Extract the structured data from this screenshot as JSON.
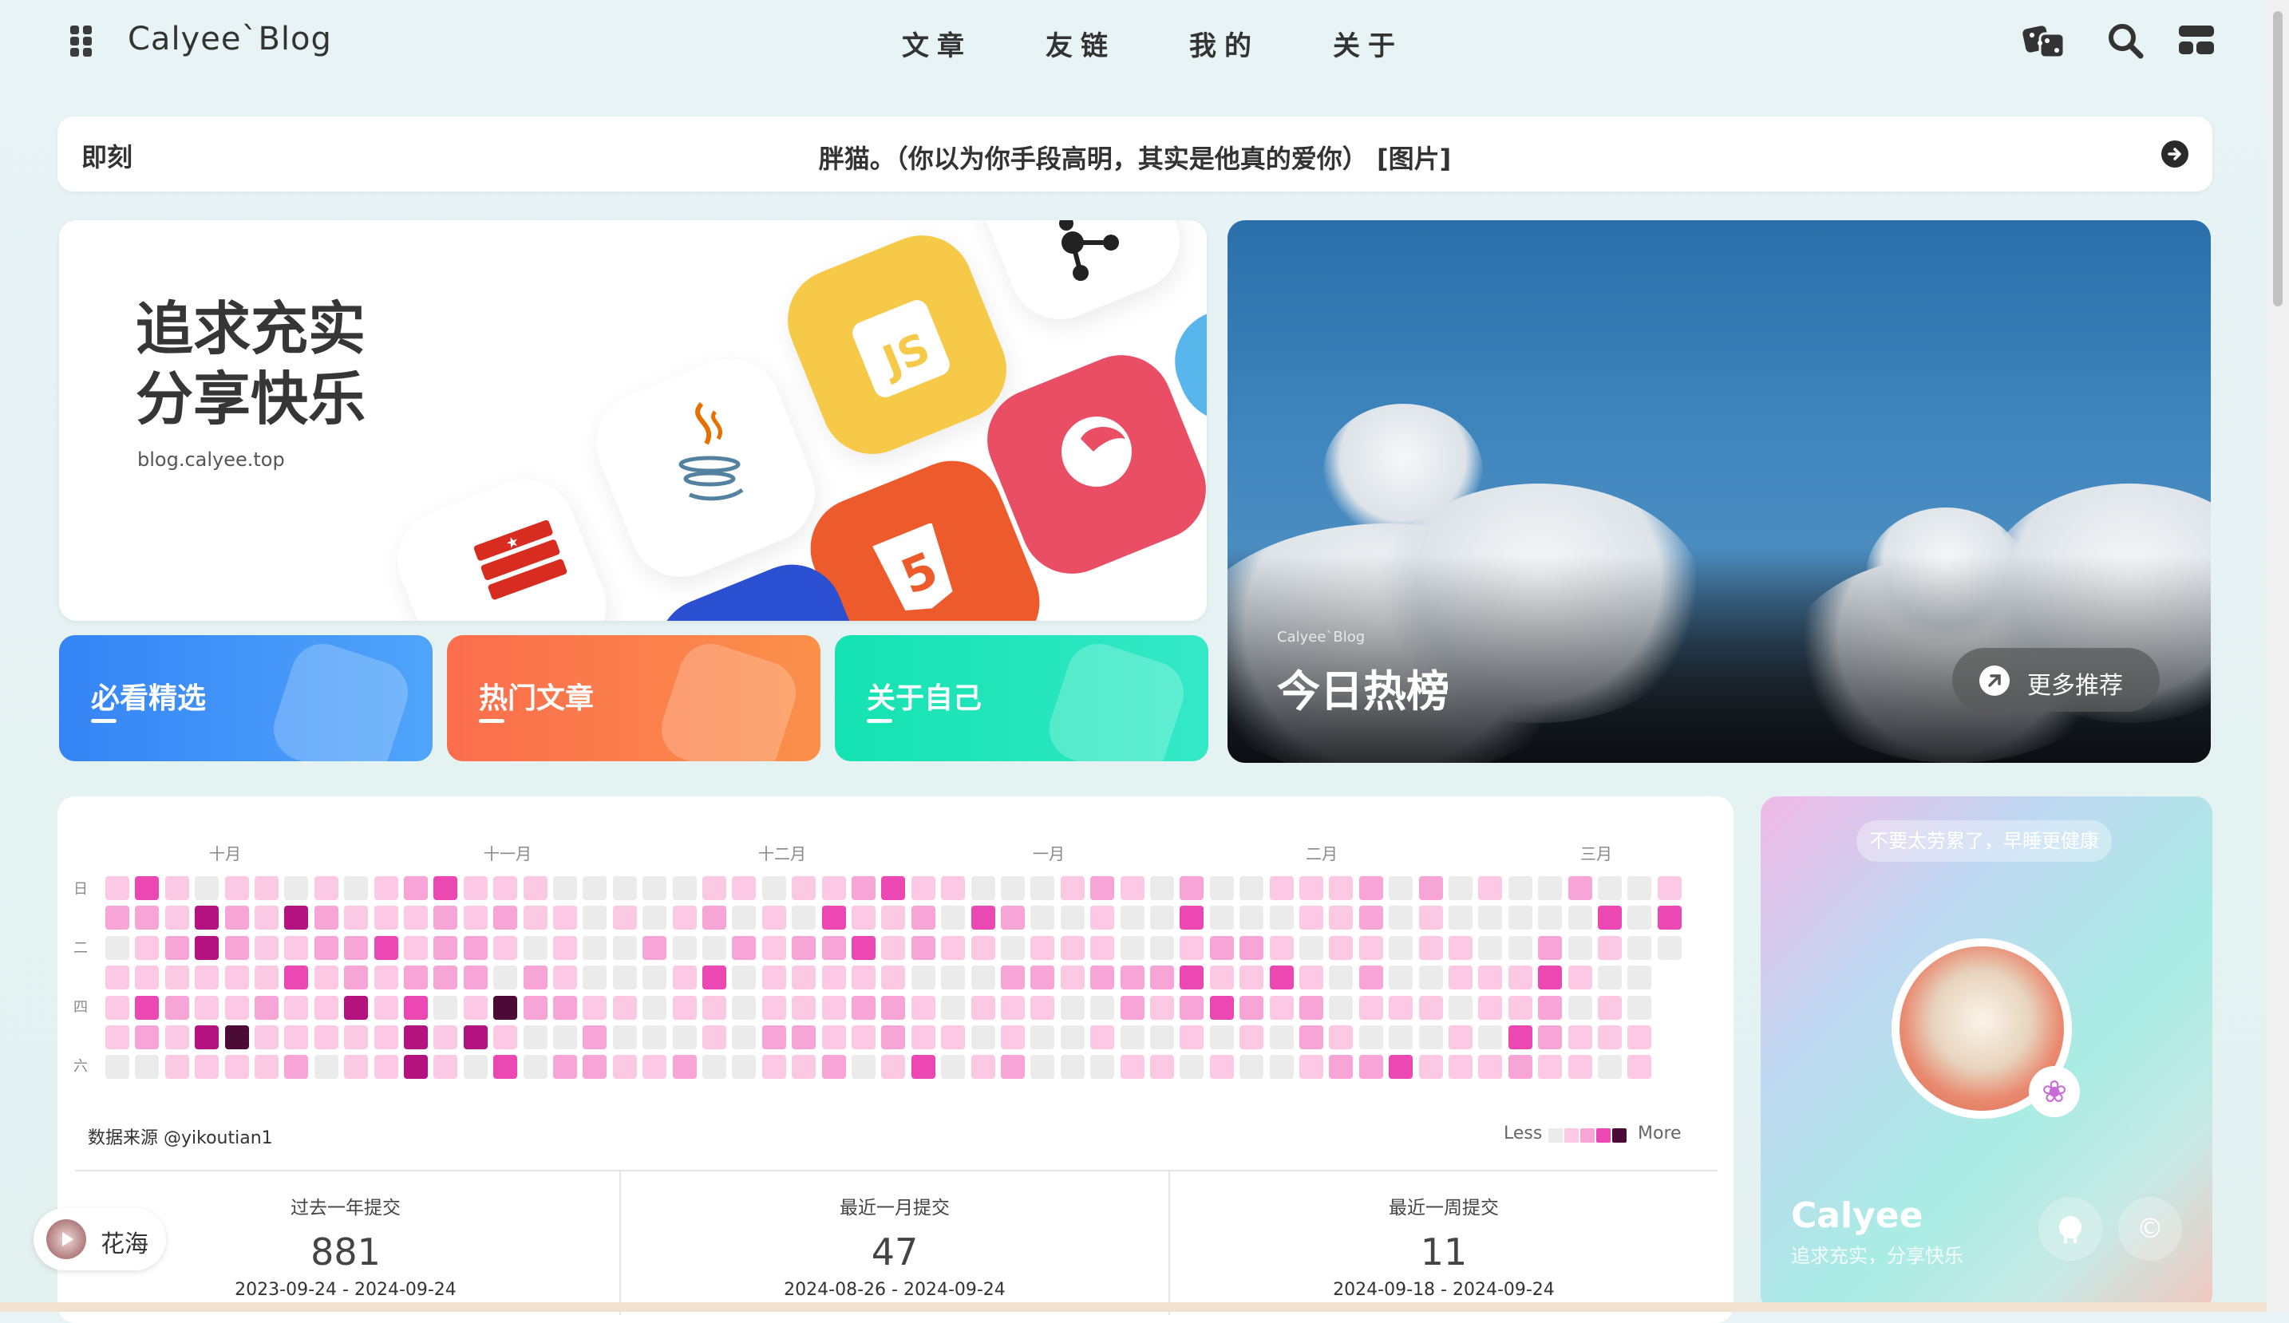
{
  "nav": {
    "brand": "Calyee`Blog",
    "links": [
      "文章",
      "友链",
      "我的",
      "关于"
    ]
  },
  "moment": {
    "tag": "即刻",
    "message": "胖猫。（你以为你手段高明，其实是他真的爱你） [图片]"
  },
  "hero": {
    "title_line1": "追求充实",
    "title_line2": "分享快乐",
    "site": "blog.calyee.top"
  },
  "categories": [
    {
      "label": "必看精选",
      "color": "#3f8cf6"
    },
    {
      "label": "热门文章",
      "color": "#fa7a4c"
    },
    {
      "label": "关于自己",
      "color": "#1fe2b4"
    }
  ],
  "hot": {
    "small": "Calyee`Blog",
    "title": "今日热榜",
    "more": "更多推荐"
  },
  "contrib": {
    "months": [
      "十月",
      "十一月",
      "十二月",
      "一月",
      "二月",
      "三月"
    ],
    "weekdays": [
      "日",
      "二",
      "四",
      "六"
    ],
    "source": "数据来源 @yikoutian1",
    "legend_less": "Less",
    "legend_more": "More",
    "palette": [
      "#ebebeb",
      "#fbc9e4",
      "#f7a4d6",
      "#ec48b4",
      "#b4137f",
      "#4c0a36"
    ],
    "stats": [
      {
        "label": "过去一年提交",
        "value": "881",
        "range": "2023-09-24 - 2024-09-24"
      },
      {
        "label": "最近一月提交",
        "value": "47",
        "range": "2024-08-26 - 2024-09-24"
      },
      {
        "label": "最近一周提交",
        "value": "11",
        "range": "2024-09-18 - 2024-09-24"
      }
    ]
  },
  "profile": {
    "motto": "不要太劳累了，早睡更健康",
    "name": "Calyee",
    "subtitle": "追求充实，分享快乐"
  },
  "music": {
    "title": "花海"
  }
}
